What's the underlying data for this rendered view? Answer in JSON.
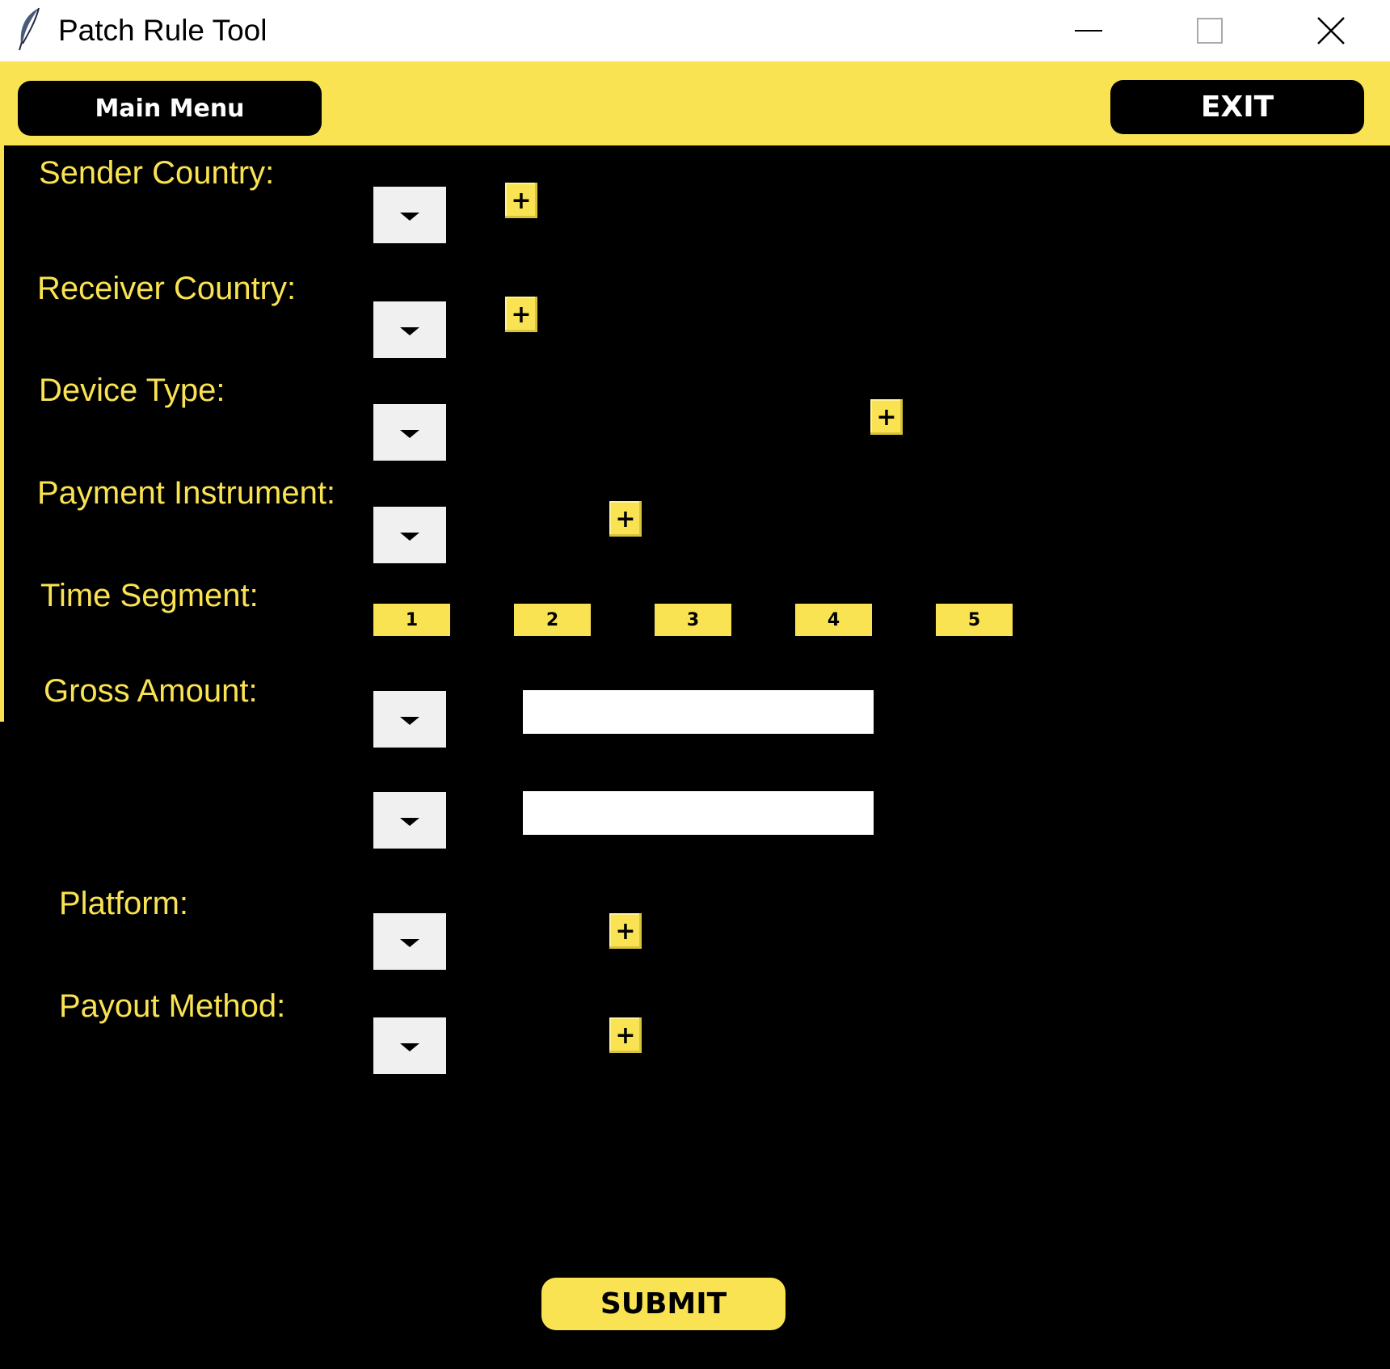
{
  "window": {
    "title": "Patch Rule Tool",
    "icon": "feather-icon",
    "controls": [
      "minimize-icon",
      "maximize-icon",
      "close-icon"
    ]
  },
  "toolbar": {
    "main_menu_label": "Main Menu",
    "exit_label": "EXIT"
  },
  "form": {
    "sender_country_label": "Sender Country:",
    "receiver_country_label": "Receiver Country:",
    "device_type_label": "Device Type:",
    "payment_instrument_label": "Payment Instrument:",
    "time_segment_label": "Time Segment:",
    "time_segments": [
      "1",
      "2",
      "3",
      "4",
      "5"
    ],
    "gross_amount_label": "Gross Amount:",
    "gross_amount_values": [
      "",
      ""
    ],
    "platform_label": "Platform:",
    "payout_method_label": "Payout Method:",
    "add_button_symbol": "+"
  },
  "submit_label": "SUBMIT",
  "colors": {
    "accent": "#fae352",
    "background": "#000000",
    "dropdown": "#f0f0f0"
  }
}
